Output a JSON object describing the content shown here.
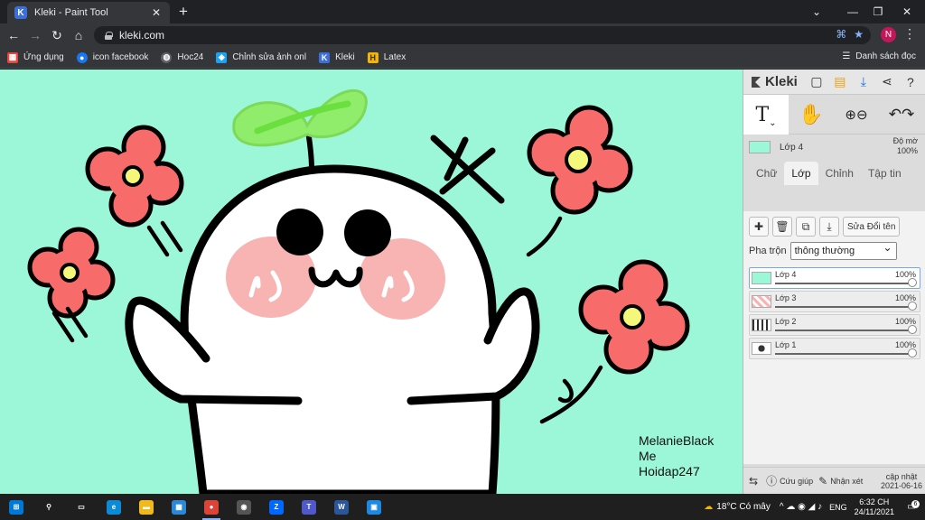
{
  "browser": {
    "tab_title": "Kleki - Paint Tool",
    "tab_close": "✕",
    "new_tab": "+",
    "url": "kleki.com",
    "profile_initial": "N",
    "window_controls": [
      "⌄",
      "—",
      "❐",
      "✕"
    ],
    "bookmarks": [
      {
        "label": "Ứng dụng",
        "icon": "apps-grid-icon",
        "color": "#e8453c"
      },
      {
        "label": "icon facebook",
        "icon": "facebook-icon",
        "color": "#1877f2"
      },
      {
        "label": "Hoc24",
        "icon": "globe-icon",
        "color": "#5f6368"
      },
      {
        "label": "Chỉnh sửa ảnh onl",
        "icon": "photo-editor-icon",
        "color": "#1da1f2"
      },
      {
        "label": "Kleki",
        "icon": "kleki-icon",
        "color": "#3b6fd9"
      },
      {
        "label": "Latex",
        "icon": "latex-icon",
        "color": "#f4b400"
      }
    ],
    "reading_list": "Danh sách đọc"
  },
  "canvas": {
    "background": "#9bf7d8",
    "watermark": [
      "MelanieBlack",
      "Me",
      "Hoidap247"
    ]
  },
  "panel": {
    "app_name": "Kleki",
    "top_icons": [
      "new-image-icon",
      "save-icon",
      "download-icon",
      "share-icon",
      "help-icon"
    ],
    "tools": [
      {
        "name": "text-tool",
        "label": "T"
      },
      {
        "name": "hand-tool",
        "label": "✋"
      },
      {
        "name": "zoom-tool",
        "label": "⊕⊖"
      },
      {
        "name": "undo-redo",
        "label": "↶↷"
      }
    ],
    "current_layer": {
      "name": "Lớp 4",
      "opacity_label": "Độ mờ",
      "opacity": "100%"
    },
    "tabs": [
      "Chữ",
      "Lớp",
      "Chỉnh",
      "Tập tin"
    ],
    "active_tab": "Lớp",
    "rename_label": "Sửa Đổi tên",
    "blend_label": "Pha trộn",
    "blend_value": "thông thường",
    "layers": [
      {
        "name": "Lớp 4",
        "opacity": "100%",
        "opacity_value": 1.0,
        "selected": true
      },
      {
        "name": "Lớp 3",
        "opacity": "100%",
        "opacity_value": 1.0,
        "selected": false
      },
      {
        "name": "Lớp 2",
        "opacity": "100%",
        "opacity_value": 1.0,
        "selected": false
      },
      {
        "name": "Lớp 1",
        "opacity": "100%",
        "opacity_value": 1.0,
        "selected": false
      }
    ],
    "footer": {
      "switch_icon": "⇆",
      "help": "Cứu giúp",
      "feedback": "Nhận xét",
      "update_label": "cập nhật",
      "update_date": "2021-06-16"
    }
  },
  "taskbar": {
    "apps": [
      {
        "name": "start",
        "color": "#0078d7",
        "label": "⊞"
      },
      {
        "name": "search",
        "color": "transparent",
        "label": "⚲"
      },
      {
        "name": "task-view",
        "color": "transparent",
        "label": "▭"
      },
      {
        "name": "edge",
        "color": "#0c8ad6",
        "label": "e"
      },
      {
        "name": "file-explorer",
        "color": "#f2b91d",
        "label": "▬"
      },
      {
        "name": "store",
        "color": "#2b88d8",
        "label": "▦"
      },
      {
        "name": "chrome",
        "color": "#db4437",
        "label": "●"
      },
      {
        "name": "camera",
        "color": "#555555",
        "label": "◉"
      },
      {
        "name": "zalo",
        "color": "#0068ff",
        "label": "Z"
      },
      {
        "name": "teams",
        "color": "#5059c9",
        "label": "T"
      },
      {
        "name": "word",
        "color": "#2b579a",
        "label": "W"
      },
      {
        "name": "app-extra",
        "color": "#1e88e5",
        "label": "▣"
      }
    ],
    "active_app": "chrome",
    "weather": "18°C Có mây",
    "tray_symbols": "^ ☁ ◉ ◢ ♪",
    "language": "ENG",
    "time": "6:32 CH",
    "date": "24/11/2021",
    "notifications": "6"
  }
}
